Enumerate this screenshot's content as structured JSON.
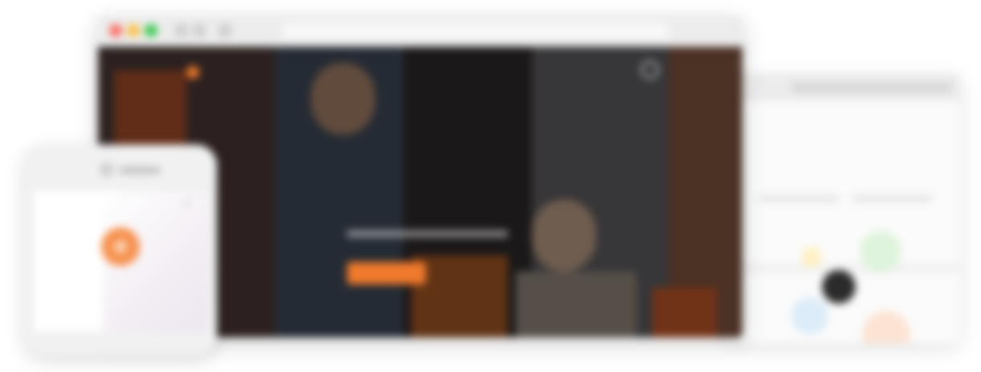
{
  "main_browser": {
    "brand": "",
    "nav_items": [
      "",
      "",
      "",
      "",
      ""
    ],
    "hero": {
      "eyebrow": "",
      "title": "",
      "cta_label": "",
      "secondary_link": ""
    }
  },
  "phone": {
    "brand": ""
  },
  "back_browser": {
    "stats": [
      {
        "value": "",
        "label": ""
      },
      {
        "value": "",
        "label": ""
      }
    ]
  },
  "colors": {
    "accent": "#f07a2c",
    "hero_dark": "#2a2426",
    "window_chrome": "#ececec"
  },
  "icons": [
    "close-dot-icon",
    "minimize-dot-icon",
    "maximize-dot-icon",
    "search-icon",
    "logo-icon"
  ]
}
